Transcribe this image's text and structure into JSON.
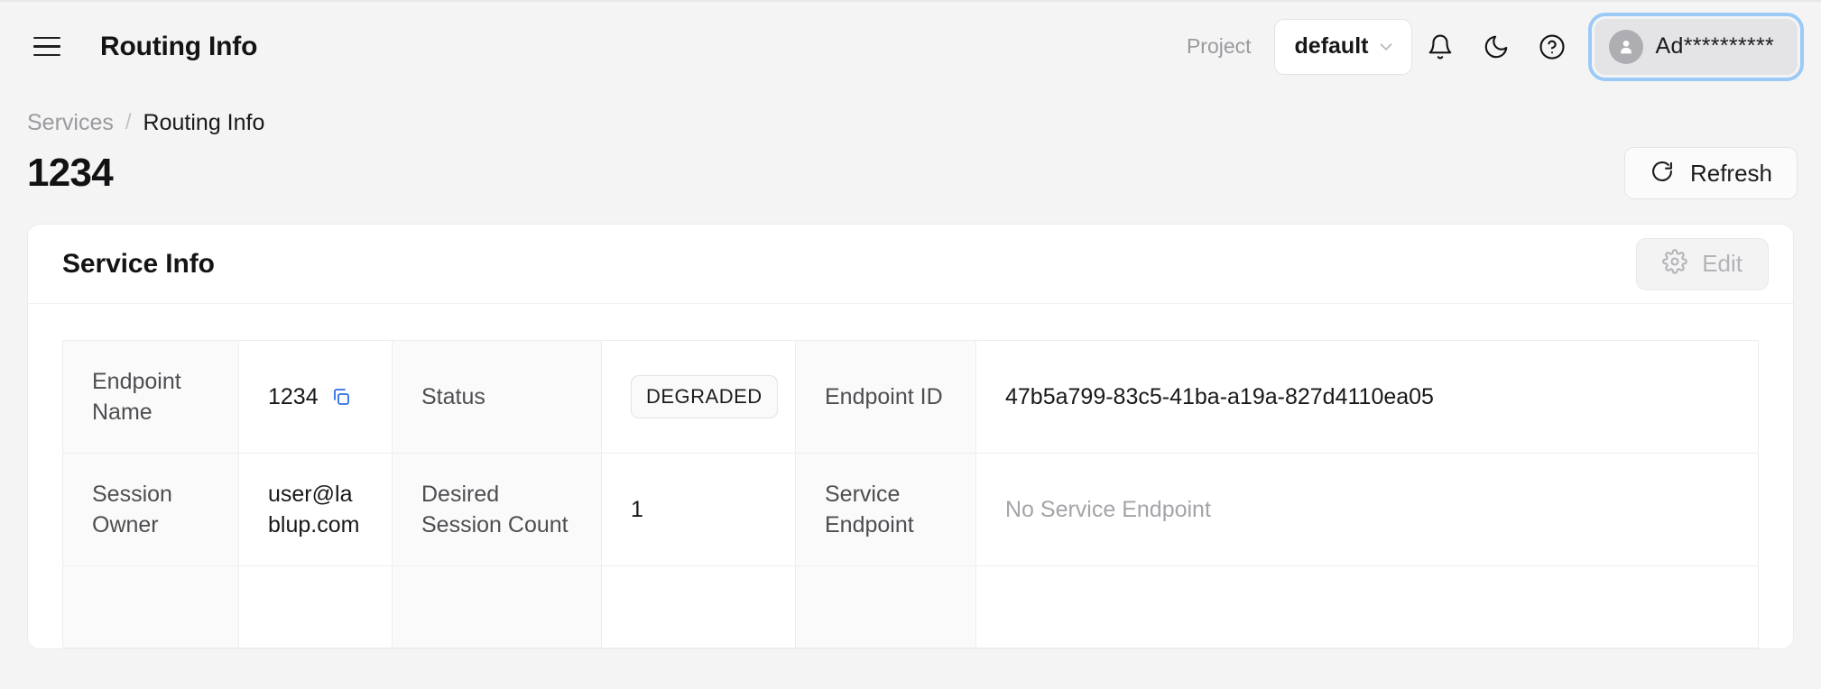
{
  "header": {
    "menu_icon": "hamburger-icon",
    "title": "Routing Info",
    "project_label": "Project",
    "project_value": "default",
    "icons": [
      "bell-icon",
      "moon-icon",
      "help-circle-icon"
    ],
    "user_name": "Ad**********",
    "focus_ring_color": "#9ccaf7"
  },
  "breadcrumb": {
    "parent": "Services",
    "separator": "/",
    "current": "Routing Info"
  },
  "page": {
    "title": "1234",
    "refresh_label": "Refresh",
    "refresh_icon": "refresh-cw-icon"
  },
  "card": {
    "title": "Service Info",
    "edit_label": "Edit",
    "edit_icon": "gear-icon",
    "edit_disabled": true
  },
  "info_table": {
    "rows": [
      {
        "label1": "Endpoint Name",
        "value1": "1234",
        "value1_has_copy": true,
        "copy_icon": "copy-icon",
        "copy_icon_color": "#2f6fe4",
        "label2": "Status",
        "value2": "DEGRADED",
        "value2_is_badge": true,
        "label3": "Endpoint ID",
        "value3": "47b5a799-83c5-41ba-a19a-827d4110ea05"
      },
      {
        "label1": "Session Owner",
        "value1": "user@lablup.com",
        "value1_has_copy": false,
        "label2": "Desired Session Count",
        "value2": "1",
        "value2_is_badge": false,
        "label3": "Service Endpoint",
        "value3": "No Service Endpoint",
        "value3_muted": true
      }
    ]
  },
  "colors": {
    "page_bg": "#f4f4f5",
    "card_bg": "#ffffff",
    "label_cell_bg": "#fafafa",
    "text": "#18181b",
    "muted": "#a4a4a9",
    "accent": "#2f6fe4"
  }
}
